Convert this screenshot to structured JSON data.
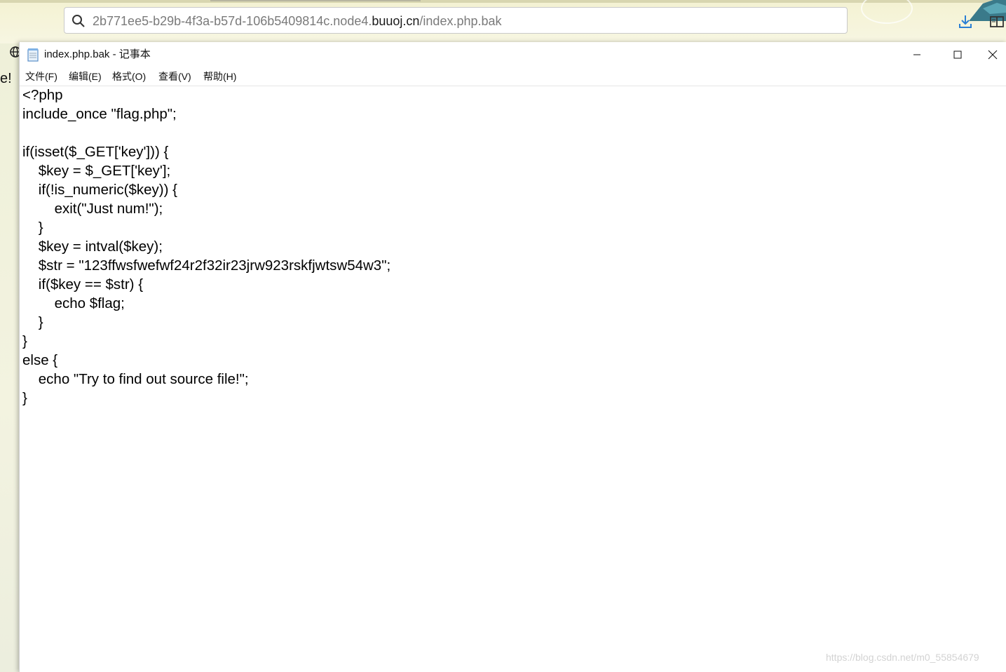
{
  "browser": {
    "url_prefix": "2b771ee5-b29b-4f3a-b57d-106b5409814c.node4.",
    "url_domain": "buuoj.cn",
    "url_path": "/index.php.bak",
    "behind_text": "e!"
  },
  "notepad": {
    "title": "index.php.bak - 记事本",
    "menu": [
      "文件(F)",
      "编辑(E)",
      "格式(O)",
      "查看(V)",
      "帮助(H)"
    ],
    "content": "<?php\ninclude_once \"flag.php\";\n\nif(isset($_GET['key'])) {\n    $key = $_GET['key'];\n    if(!is_numeric($key)) {\n        exit(\"Just num!\");\n    }\n    $key = intval($key);\n    $str = \"123ffwsfwefwf24r2f32ir23jrw923rskfjwtsw54w3\";\n    if($key == $str) {\n        echo $flag;\n    }\n}\nelse {\n    echo \"Try to find out source file!\";\n}"
  },
  "watermark": "https://blog.csdn.net/m0_55854679",
  "icons": {
    "search": "search-icon",
    "download": "download-icon",
    "reader": "reader-mode-icon",
    "globe": "globe-icon",
    "notepad": "notepad-icon",
    "minimize": "minimize-icon",
    "maximize": "maximize-icon",
    "close": "close-icon"
  }
}
